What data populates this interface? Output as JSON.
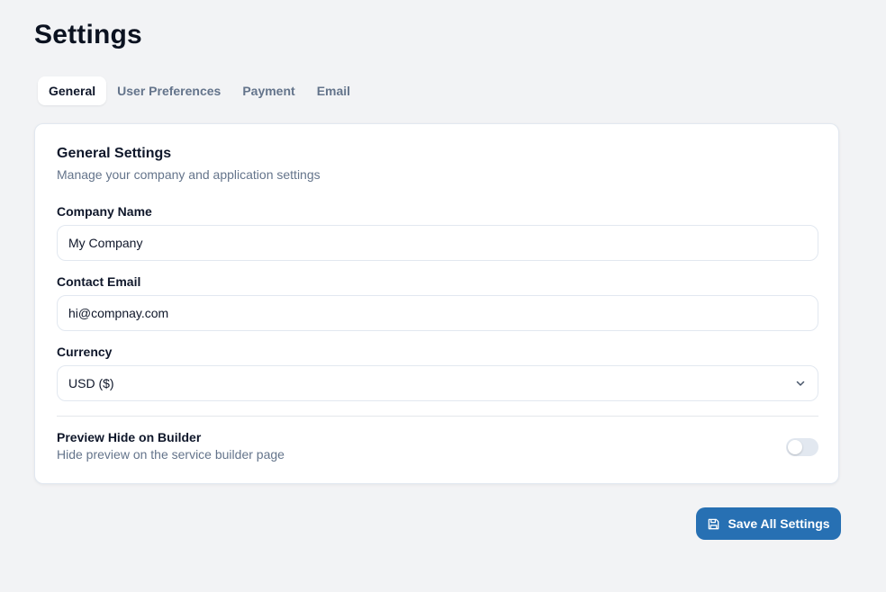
{
  "page": {
    "title": "Settings"
  },
  "tabs": [
    {
      "label": "General",
      "active": true
    },
    {
      "label": "User Preferences",
      "active": false
    },
    {
      "label": "Payment",
      "active": false
    },
    {
      "label": "Email",
      "active": false
    }
  ],
  "card": {
    "title": "General Settings",
    "subtitle": "Manage your company and application settings",
    "company_name": {
      "label": "Company Name",
      "value": "My Company"
    },
    "contact_email": {
      "label": "Contact Email",
      "value": "hi@compnay.com"
    },
    "currency": {
      "label": "Currency",
      "selected": "USD ($)",
      "icon": "chevron-down-icon"
    },
    "preview_toggle": {
      "label": "Preview Hide on Builder",
      "description": "Hide preview on the service builder page",
      "enabled": false
    }
  },
  "actions": {
    "save_label": "Save All Settings",
    "save_icon": "floppy-disk-icon"
  },
  "colors": {
    "background": "#f2f3f5",
    "primary": "#2770b3",
    "muted_text": "#64748b",
    "border": "#e2e8f0"
  }
}
